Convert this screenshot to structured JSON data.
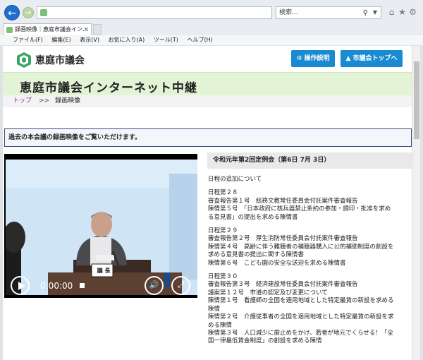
{
  "browser": {
    "search_placeholder": "検索...",
    "tab_title": "録画映像｜恵庭市議会イン...",
    "menu": [
      "ファイル(F)",
      "編集(E)",
      "表示(V)",
      "お気に入り(A)",
      "ツール(T)",
      "ヘルプ(H)"
    ]
  },
  "site": {
    "logo_text": "恵庭市議会",
    "btn_guide": "操作説明",
    "btn_top": "市議会トップへ",
    "page_title": "恵庭市議会インターネット中継",
    "breadcrumb": {
      "home": "トップ",
      "separator": ">>",
      "current": "録画映像"
    },
    "notice": "過去の本会議の録画映像をご覧いただけます。",
    "accent_color": "#1a8bd1"
  },
  "player": {
    "time": "0:00:00",
    "nameplate_title": "議 長",
    "progress_percent": 0
  },
  "session": {
    "heading": "令和元年第2回定例会（第6日 7月 3日）",
    "agenda": [
      "日程の追加について",
      "",
      "日程第２８",
      "審査報告第１号　総務文教常任委員会付託案件審査報告",
      "陳情第５号　「日本政府に核兵器禁止条約の参加・調印・批准を求め",
      "る意見書」の提出を求める陳情書",
      "",
      "日程第２９",
      "審査報告第２号　厚生消防常任委員会付託案件審査報告",
      "陳情第４号　高齢に伴う難聴者の補聴器購入に公的補助制度の創設を",
      "求める意見書の提出に関する陳情書",
      "陳情第６号　こども園の安全な送迎を求める陳情書",
      "",
      "日程第３０",
      "審査報告第３号　経済建設常任委員会付託案件審査報告",
      "議案第１２号　市道の認定及び変更について",
      "陳情第１号　看護師の全国を適用地域とした特定最賃の新設を求める",
      "陳情",
      "陳情第２号　介護従事者の全国を適用地域とした特定最賃の新設を求",
      "める陳情",
      "陳情第３号　人口減少に歯止めをかけ、若者が地元でくらせる！「全",
      "国一律最低賃金制度」の創設を求める陳情"
    ]
  }
}
